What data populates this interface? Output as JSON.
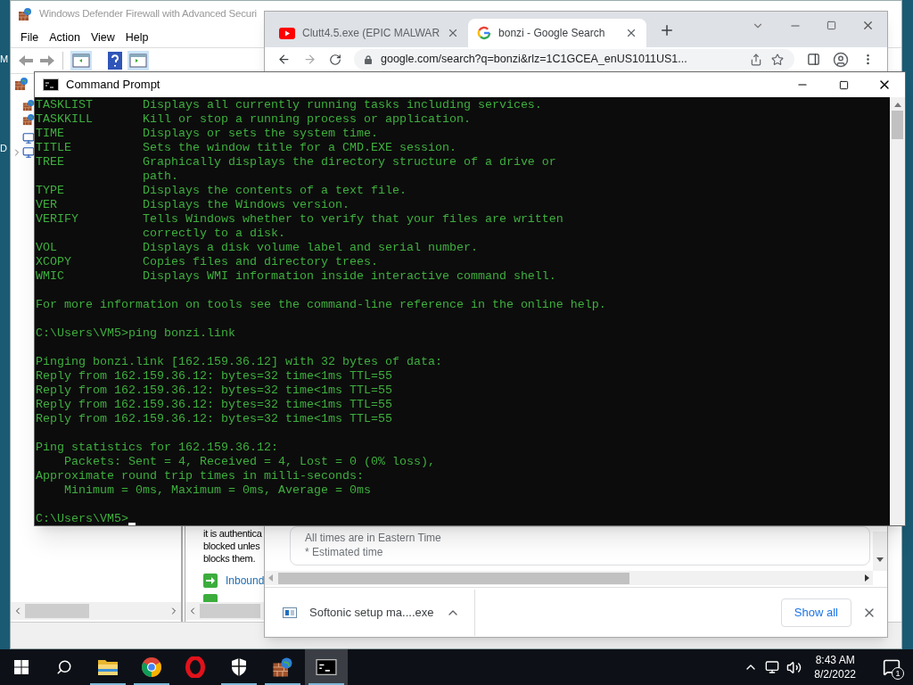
{
  "desktop": {
    "icon_labels": [
      "M",
      "D"
    ]
  },
  "firewall": {
    "title": "Windows Defender Firewall with Advanced Securi",
    "menu": [
      "File",
      "Action",
      "View",
      "Help"
    ],
    "description_lines": [
      "it is authentica",
      "blocked unles",
      "blocks them."
    ],
    "link": "Inbound"
  },
  "browser": {
    "tabs": [
      {
        "title": "Clutt4.5.exe (EPIC MALWAR",
        "selected": false,
        "kind": "video"
      },
      {
        "title": "bonzi - Google Search",
        "selected": true,
        "kind": "search"
      }
    ],
    "url": "google.com/search?q=bonzi&rlz=1C1GCEA_enUS1011US1...",
    "card_lines": [
      "All times are in Eastern Time",
      "* Estimated time"
    ],
    "download": "Softonic setup ma....exe",
    "show_all": "Show all"
  },
  "console": {
    "title": "Command Prompt",
    "blocks": [
      [
        "TASKLIST       Displays all currently running tasks including services.",
        "TASKKILL       Kill or stop a running process or application.",
        "TIME           Displays or sets the system time.",
        "TITLE          Sets the window title for a CMD.EXE session.",
        "TREE           Graphically displays the directory structure of a drive or",
        "               path.",
        "TYPE           Displays the contents of a text file.",
        "VER            Displays the Windows version.",
        "VERIFY         Tells Windows whether to verify that your files are written",
        "               correctly to a disk.",
        "VOL            Displays a disk volume label and serial number.",
        "XCOPY          Copies files and directory trees.",
        "WMIC           Displays WMI information inside interactive command shell."
      ],
      [
        "For more information on tools see the command-line reference in the online help."
      ],
      [
        "C:\\Users\\VM5>ping bonzi.link"
      ],
      [
        "Pinging bonzi.link [162.159.36.12] with 32 bytes of data:",
        "Reply from 162.159.36.12: bytes=32 time<1ms TTL=55",
        "Reply from 162.159.36.12: bytes=32 time<1ms TTL=55",
        "Reply from 162.159.36.12: bytes=32 time<1ms TTL=55",
        "Reply from 162.159.36.12: bytes=32 time<1ms TTL=55"
      ],
      [
        "Ping statistics for 162.159.36.12:",
        "    Packets: Sent = 4, Received = 4, Lost = 0 (0% loss),",
        "Approximate round trip times in milli-seconds:",
        "    Minimum = 0ms, Maximum = 0ms, Average = 0ms"
      ],
      [
        "C:\\Users\\VM5>"
      ]
    ]
  },
  "taskbar": {
    "apps": [
      {
        "kind": "explorer",
        "running": true,
        "selected": false
      },
      {
        "kind": "chrome",
        "running": true,
        "selected": false
      },
      {
        "kind": "opera",
        "running": false,
        "selected": false
      },
      {
        "kind": "security",
        "running": true,
        "selected": false
      },
      {
        "kind": "firewall",
        "running": true,
        "selected": false
      },
      {
        "kind": "cmd",
        "running": true,
        "selected": true
      }
    ],
    "time": "8:43 AM",
    "date": "8/2/2022",
    "notifications": "1"
  }
}
